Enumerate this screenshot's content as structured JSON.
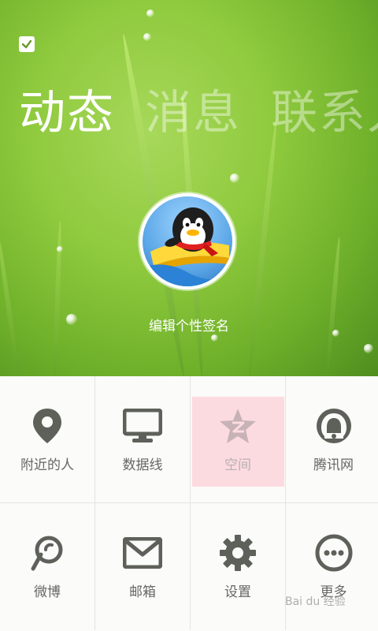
{
  "header": {
    "tabs": [
      {
        "label": "动态",
        "active": true
      },
      {
        "label": "消息",
        "active": false
      },
      {
        "label": "联系人",
        "active": false
      }
    ],
    "signature_placeholder": "编辑个性签名"
  },
  "grid": {
    "items": [
      {
        "label": "附近的人",
        "icon": "location-pin-icon"
      },
      {
        "label": "数据线",
        "icon": "monitor-icon"
      },
      {
        "label": "空间",
        "icon": "qzone-star-icon",
        "highlighted": true
      },
      {
        "label": "腾讯网",
        "icon": "tencent-bell-icon"
      },
      {
        "label": "微博",
        "icon": "weibo-icon"
      },
      {
        "label": "邮箱",
        "icon": "mail-icon"
      },
      {
        "label": "设置",
        "icon": "gear-icon"
      },
      {
        "label": "更多",
        "icon": "more-dots-icon"
      }
    ]
  },
  "watermark": "Bai du 经验",
  "colors": {
    "icon": "#5e605a",
    "label": "#666666",
    "highlight_bg": "#fcdbe0",
    "header_green": "#8fca3e"
  }
}
